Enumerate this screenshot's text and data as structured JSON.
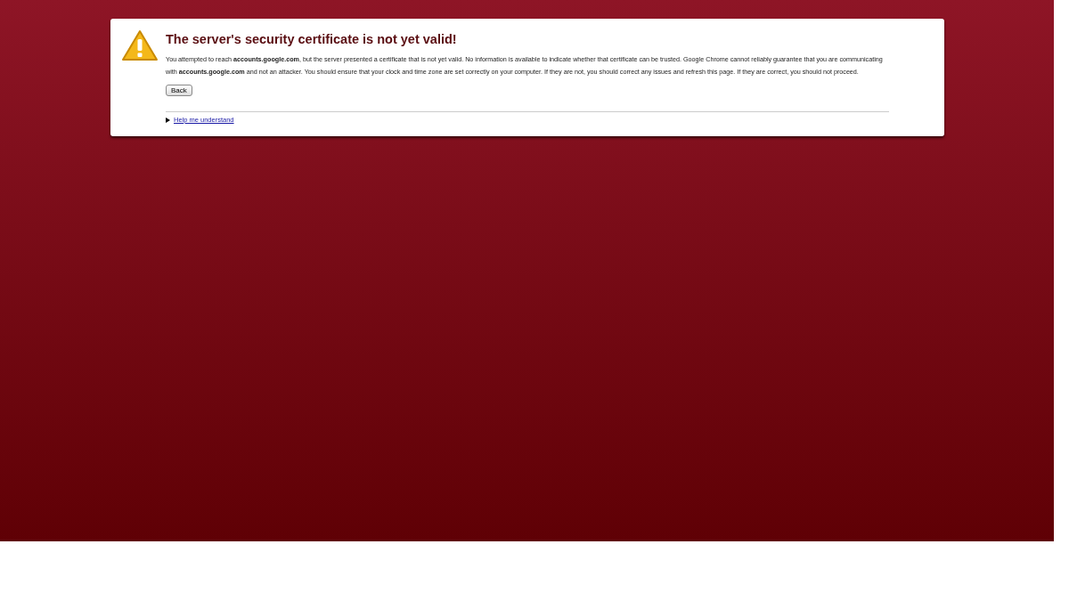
{
  "title": "The server's security certificate is not yet valid!",
  "message": "You attempted to reach **accounts.google.com**, but the server presented a certificate that is not yet valid. No information is available to indicate whether that certificate can be trusted. Google Chrome cannot reliably guarantee that you are communicating with **accounts.google.com** and not an attacker. You should ensure that your clock and time zone are set correctly on your computer. If they are not, you should correct any issues and refresh this page. If they are correct, you should not proceed.",
  "buttons": [
    "Back"
  ],
  "help": {
    "label": "Help me understand",
    "expanded": false
  }
}
